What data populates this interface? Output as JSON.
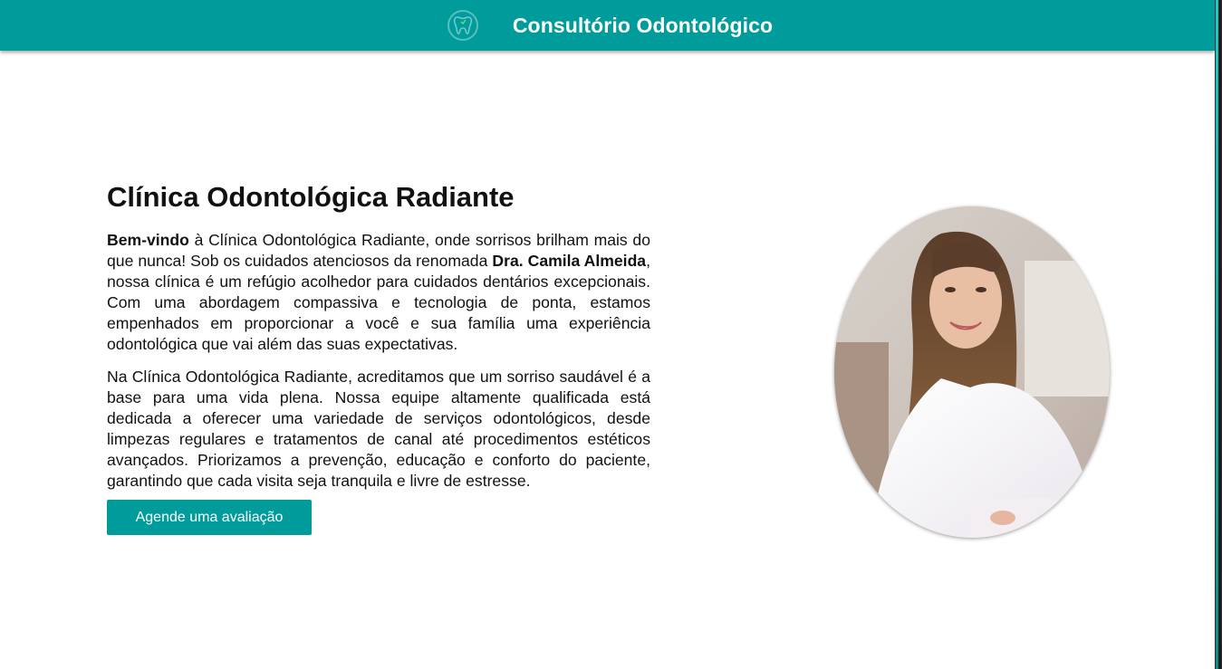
{
  "header": {
    "title": "Consultório Odontológico",
    "logo_icon": "tooth-icon",
    "background_color": "#009b9b"
  },
  "main": {
    "heading": "Clínica Odontológica Radiante",
    "paragraph1": {
      "lead": "Bem-vindo",
      "text1": " à Clínica Odontológica Radiante, onde sorrisos brilham mais do que nunca! Sob os cuidados atenciosos da renomada ",
      "doctor": "Dra. Camila Almeida",
      "text2": ", nossa clínica é um refúgio acolhedor para cuidados dentários excepcionais. Com uma abordagem compassiva e tecnologia de ponta, estamos empenhados em proporcionar a você e sua família uma experiência odontológica que vai além das suas expectativas."
    },
    "paragraph2": "Na Clínica Odontológica Radiante, acreditamos que um sorriso saudável é a base para uma vida plena. Nossa equipe altamente qualificada está dedicada a oferecer uma variedade de serviços odontológicos, desde limpezas regulares e tratamentos de canal até procedimentos estéticos avançados. Priorizamos a prevenção, educação e conforto do paciente, garantindo que cada visita seja tranquila e livre de estresse.",
    "cta_label": "Agende uma avaliação"
  },
  "accent_color": "#009b9b"
}
